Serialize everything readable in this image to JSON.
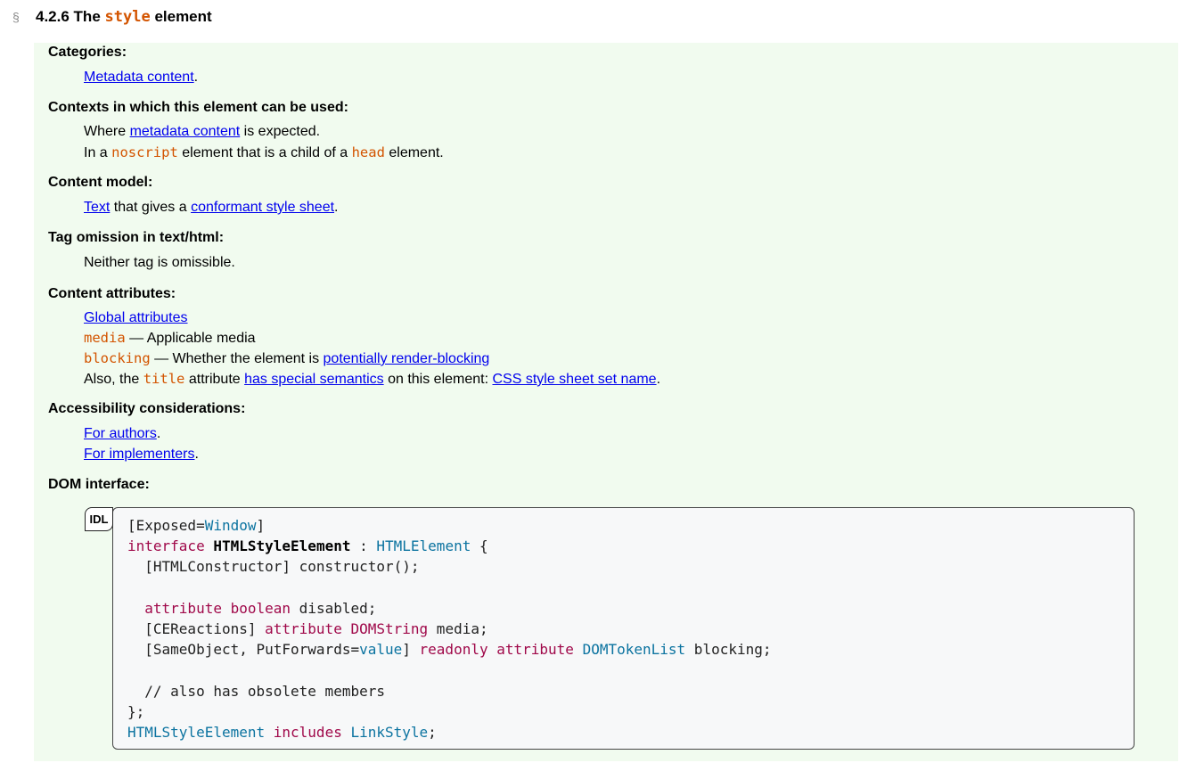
{
  "heading": {
    "self_link": "§",
    "number": "4.2.6",
    "word_the": "The",
    "element_name": "style",
    "word_element": "element"
  },
  "categories": {
    "label": "Categories:",
    "link": "Metadata content",
    "suffix": "."
  },
  "contexts": {
    "label": "Contexts in which this element can be used:",
    "line1_prefix": "Where",
    "line1_link": "metadata content",
    "line1_suffix": "is expected.",
    "line2_prefix": "In a",
    "line2_code": "noscript",
    "line2_middle": "element that is a child of a",
    "line2_code2": "head",
    "line2_suffix": "element."
  },
  "content_model": {
    "label": "Content model:",
    "link1": "Text",
    "middle": "that gives a",
    "link2": "conformant style sheet",
    "suffix": "."
  },
  "tag_omission": {
    "label": "Tag omission in text/html:",
    "text": "Neither tag is omissible."
  },
  "content_attributes": {
    "label": "Content attributes:",
    "global_link": "Global attributes",
    "media_code": "media",
    "media_desc": "— Applicable media",
    "blocking_code": "blocking",
    "blocking_desc": "— Whether the element is",
    "blocking_link": "potentially render-blocking",
    "also_prefix": "Also, the",
    "also_code": "title",
    "also_middle": "attribute",
    "also_link1": "has special semantics",
    "also_middle2": "on this element:",
    "also_link2": "CSS style sheet set name",
    "also_suffix": "."
  },
  "accessibility": {
    "label": "Accessibility considerations:",
    "authors_link": "For authors",
    "implementers_link": "For implementers",
    "suffix": "."
  },
  "dom_interface": {
    "label": "DOM interface:",
    "idl_tag": "IDL",
    "exposed_open": "[Exposed=",
    "exposed_value": "Window",
    "exposed_close": "]",
    "interface_kw": "interface",
    "interface_name": "HTMLStyleElement",
    "colon": " : ",
    "parent": "HTMLElement",
    "open_brace": " {",
    "constructor": "  [HTMLConstructor] constructor();",
    "attr_kw": "attribute",
    "boolean_kw": "boolean",
    "disabled": " disabled;",
    "ceReactions": "  [CEReactions] ",
    "domstring": "DOMString",
    "media": " media;",
    "sameobject": "  [SameObject, PutForwards=",
    "value": "value",
    "bracket_close": "] ",
    "readonly_kw": "readonly",
    "domtokenlist": "DOMTokenList",
    "blocking": " blocking;",
    "comment": "  // also has obsolete members",
    "close_brace": "};",
    "includes_left": "HTMLStyleElement",
    "includes_kw": "includes",
    "includes_right": "LinkStyle",
    "semicolon": ";"
  }
}
